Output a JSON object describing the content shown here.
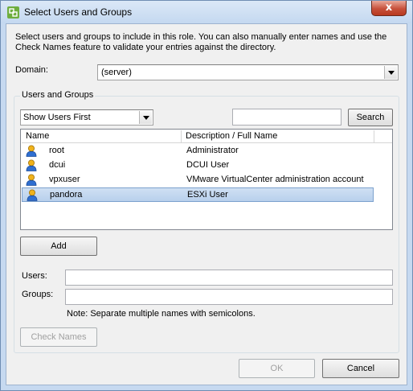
{
  "window": {
    "title": "Select Users and Groups",
    "close_glyph": "x"
  },
  "instructions": "Select users and groups to include in this role. You can also manually enter names and use the Check Names feature to validate your entries against the directory.",
  "domain": {
    "label": "Domain:",
    "value": "(server)"
  },
  "users_groups": {
    "group_label": "Users and Groups",
    "filter_value": "Show Users First",
    "search_value": "",
    "search_label": "Search",
    "columns": [
      "Name",
      "Description / Full Name"
    ],
    "rows": [
      {
        "name": "root",
        "description": "Administrator",
        "selected": false
      },
      {
        "name": "dcui",
        "description": "DCUI User",
        "selected": false
      },
      {
        "name": "vpxuser",
        "description": "VMware VirtualCenter administration account",
        "selected": false
      },
      {
        "name": "pandora",
        "description": "ESXi User",
        "selected": true
      }
    ],
    "add_label": "Add",
    "users_label": "Users:",
    "users_value": "",
    "groups_label": "Groups:",
    "groups_value": "",
    "note": "Note: Separate multiple names with semicolons.",
    "check_names_label": "Check Names"
  },
  "footer": {
    "ok_label": "OK",
    "cancel_label": "Cancel"
  },
  "icons": {
    "app": "vsphere-app-icon",
    "user": "user-icon",
    "close": "close-icon"
  }
}
